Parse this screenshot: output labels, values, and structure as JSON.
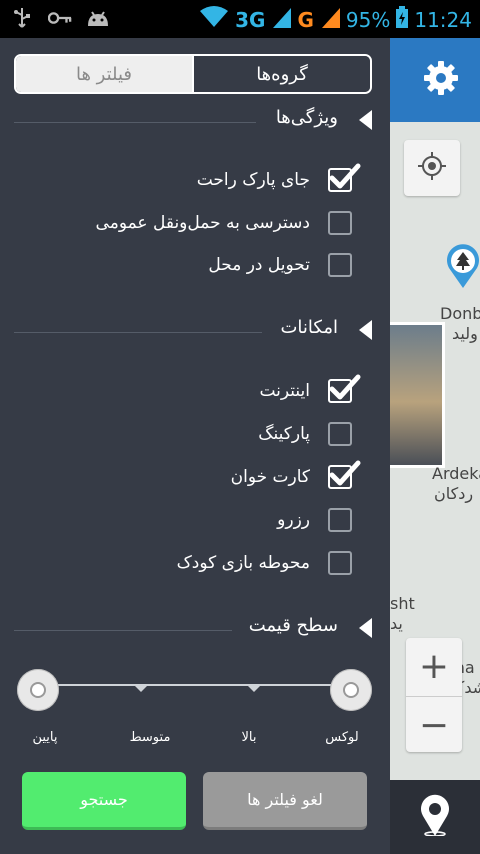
{
  "status_bar": {
    "network_3g": "3G",
    "network_g": "G",
    "battery": "95%",
    "time": "11:24",
    "icons": [
      "usb-icon",
      "key-icon",
      "android-icon",
      "wifi-icon",
      "signal-icon",
      "battery-icon"
    ]
  },
  "tabs": {
    "groups": "گروه‌ها",
    "filters": "فیلتر ها"
  },
  "sections": {
    "features": {
      "title": "ویژگی‌ها",
      "items": [
        {
          "label": "جای پارک راحت",
          "checked": true
        },
        {
          "label": "دسترسی به حمل‌ونقل عمومی",
          "checked": false
        },
        {
          "label": "تحویل در محل",
          "checked": false
        }
      ]
    },
    "amenities": {
      "title": "امکانات",
      "items": [
        {
          "label": "اینترنت",
          "checked": true
        },
        {
          "label": "پارکینگ",
          "checked": false
        },
        {
          "label": "کارت خوان",
          "checked": true
        },
        {
          "label": "رزرو",
          "checked": false
        },
        {
          "label": "محوطه بازی کودک",
          "checked": false
        }
      ]
    },
    "price": {
      "title": "سطح قیمت",
      "levels": [
        "پایین",
        "متوسط",
        "بالا",
        "لوکس"
      ],
      "range": [
        "پایین",
        "لوکس"
      ]
    }
  },
  "buttons": {
    "search": "جستجو",
    "clear_filters": "لغو فیلتر ها"
  },
  "map": {
    "labels": [
      "Donb",
      "ولید",
      "Ardeka",
      "ردکان",
      "sht",
      "ید",
      "rasha",
      "شدک"
    ]
  },
  "colors": {
    "drawer_bg": "#363b46",
    "accent_blue": "#2b79c2",
    "search_green": "#52ec6f",
    "clear_gray": "#9a9a9a"
  }
}
